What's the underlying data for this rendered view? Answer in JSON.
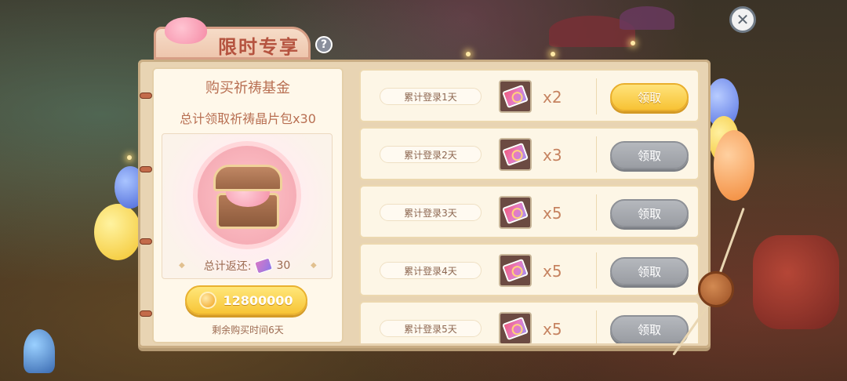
{
  "header": {
    "title": "限时专享",
    "help_icon": "?",
    "close_icon": "✕"
  },
  "fund": {
    "title": "购买祈祷基金",
    "description": "总计领取祈祷晶片包x30",
    "return_label": "总计返还:",
    "return_value": "30",
    "price": "12800000",
    "remaining": "剩余购买时间6天"
  },
  "rewards": [
    {
      "label": "累计登录1天",
      "qty": "x2",
      "button": "领取",
      "state": "active"
    },
    {
      "label": "累计登录2天",
      "qty": "x3",
      "button": "领取",
      "state": "disabled"
    },
    {
      "label": "累计登录3天",
      "qty": "x5",
      "button": "领取",
      "state": "disabled"
    },
    {
      "label": "累计登录4天",
      "qty": "x5",
      "button": "领取",
      "state": "disabled"
    },
    {
      "label": "累计登录5天",
      "qty": "x5",
      "button": "领取",
      "state": "disabled"
    }
  ],
  "colors": {
    "accent_gold": "#f7c436",
    "disabled_gray": "#9a9da3",
    "text_brown": "#b86f52",
    "panel": "#e8d4b3"
  }
}
